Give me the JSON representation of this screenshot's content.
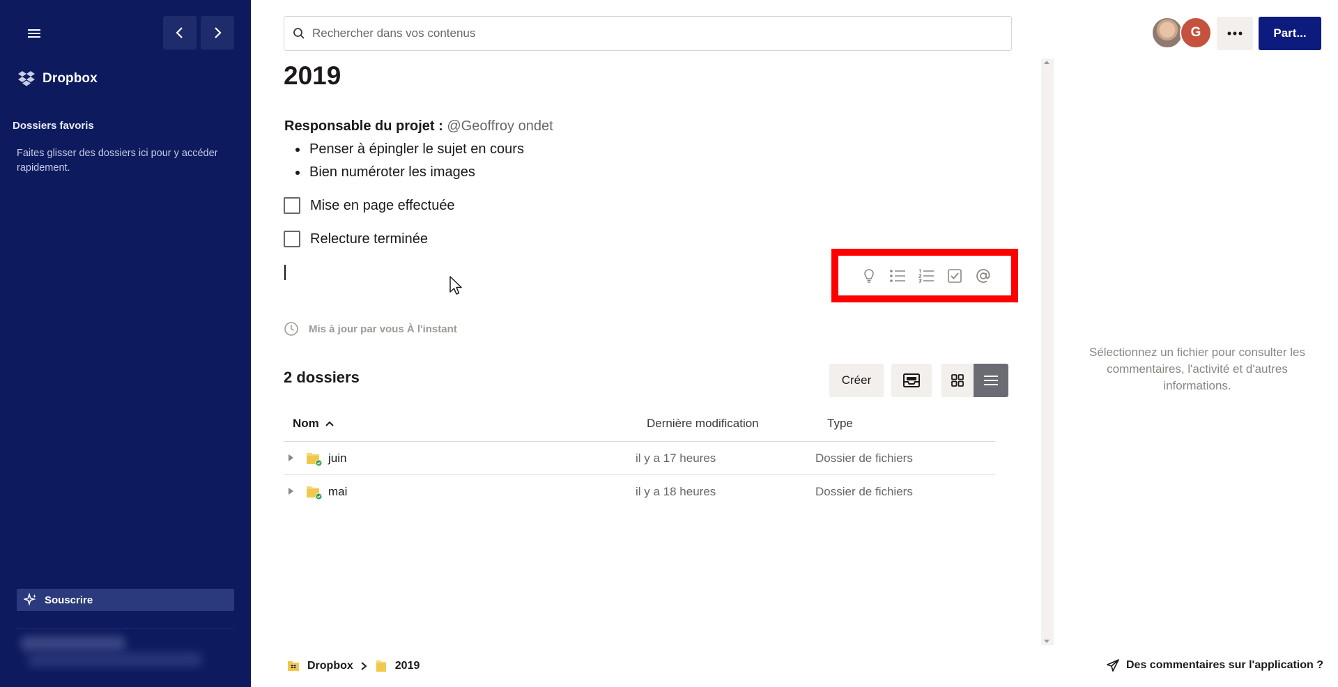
{
  "sidebar": {
    "logo_text": "Dropbox",
    "favorites_title": "Dossiers favoris",
    "favorites_hint": "Faites glisser des dossiers ici pour y accéder rapidement.",
    "subscribe_label": "Souscrire"
  },
  "topbar": {
    "search_placeholder": "Rechercher dans vos contenus",
    "avatar_initial": "G",
    "share_label": "Part..."
  },
  "document": {
    "title": "2019",
    "owner_label": "Responsable du projet :",
    "owner_mention": "@Geoffroy ondet",
    "bullets": [
      "Penser à épingler le sujet en cours",
      "Bien numéroter les images"
    ],
    "todos": [
      {
        "label": "Mise en page effectuée",
        "checked": false
      },
      {
        "label": "Relecture terminée",
        "checked": false
      }
    ],
    "toolbar_icons": [
      "lightbulb-icon",
      "bullet-list-icon",
      "numbered-list-icon",
      "checkbox-icon",
      "mention-at-icon"
    ],
    "updated_text": "Mis à jour par vous À l'instant"
  },
  "folders": {
    "title": "2 dossiers",
    "create_label": "Créer",
    "columns": {
      "name": "Nom",
      "modified": "Dernière modification",
      "type": "Type"
    },
    "rows": [
      {
        "name": "juin",
        "modified": "il y a 17 heures",
        "type": "Dossier de fichiers"
      },
      {
        "name": "mai",
        "modified": "il y a 18 heures",
        "type": "Dossier de fichiers"
      }
    ]
  },
  "info_panel": {
    "hint": "Sélectionnez un fichier pour consulter les commentaires, l'activité et d'autres informations."
  },
  "footer": {
    "breadcrumb": [
      "Dropbox",
      "2019"
    ],
    "feedback_label": "Des commentaires sur l'application ?"
  },
  "colors": {
    "sidebar_bg": "#0d1b5e",
    "primary_button": "#0d1b7e",
    "highlight": "#ff0000",
    "avatar_bg": "#c4523e"
  }
}
